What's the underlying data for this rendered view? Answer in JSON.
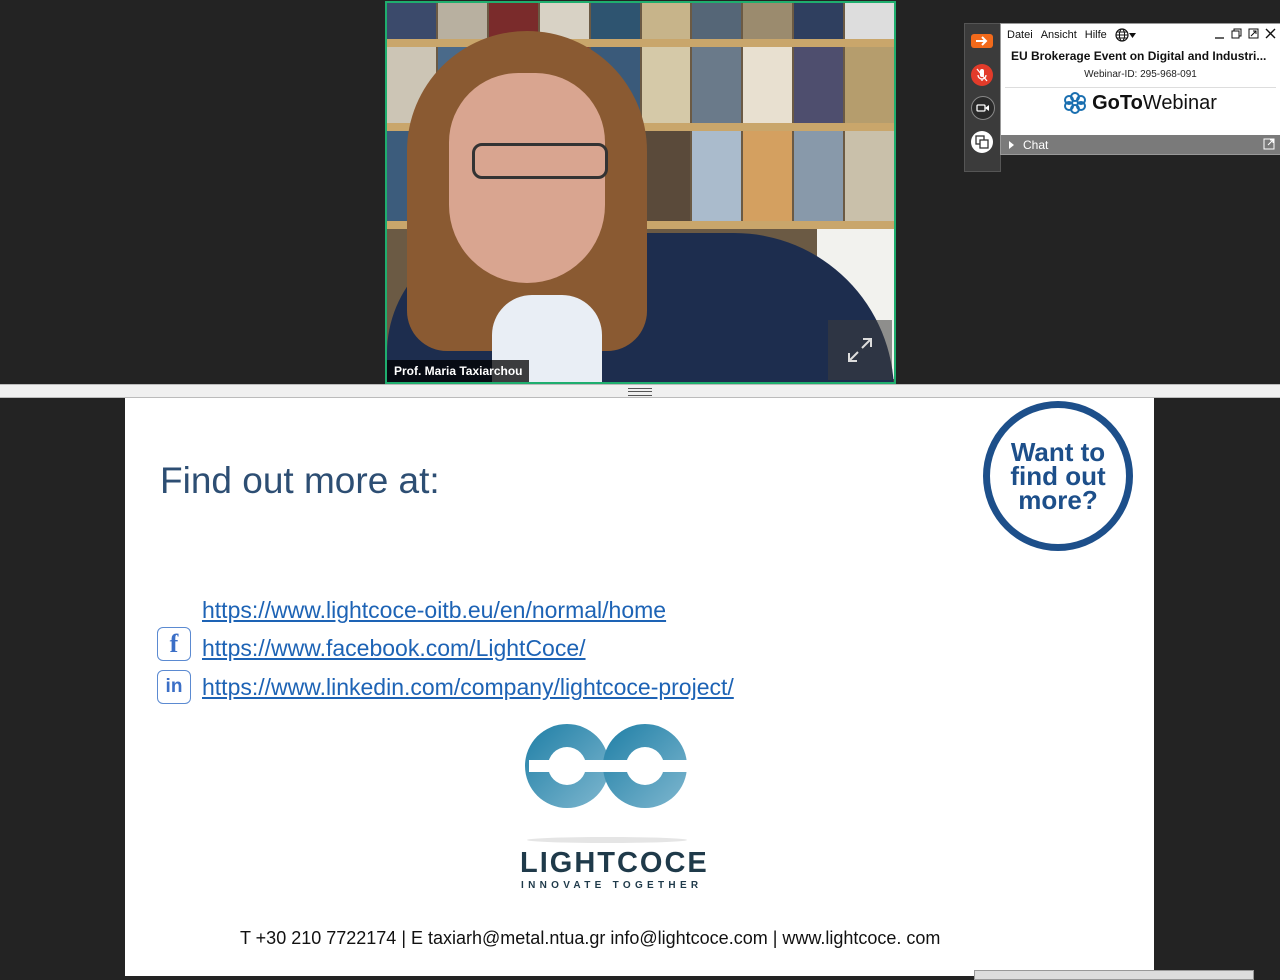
{
  "webcam": {
    "presenter_name": "Prof. Maria Taxiarchou"
  },
  "gotowebinar": {
    "menu": [
      "Datei",
      "Ansicht",
      "Hilfe"
    ],
    "event_title": "EU Brokerage Event on Digital and Industri...",
    "webinar_id": "Webinar-ID: 295-968-091",
    "logo_goto": "GoTo",
    "logo_webinar": "Webinar",
    "chat_label": "Chat"
  },
  "slide": {
    "heading": "Find out more at:",
    "badge_text": "Want to find out more?",
    "links": [
      "https://www.lightcoce-oitb.eu/en/normal/home",
      "https://www.facebook.com/LightCoce/",
      "https://www.linkedin.com/company/lightcoce-project/"
    ],
    "logo_word": "LIGHTCOCE",
    "logo_tagline": "INNOVATE TOGETHER",
    "contact": "T +30 210 7722174 | E taxiarh@metal.ntua.gr info@lightcoce.com | www.lightcoce. com"
  },
  "colors": {
    "webcam_border": "#1fae6e",
    "heading": "#2d4e73",
    "link": "#1d63b5",
    "badge": "#1d4f8a",
    "logo_teal": "#1f7fa6"
  }
}
